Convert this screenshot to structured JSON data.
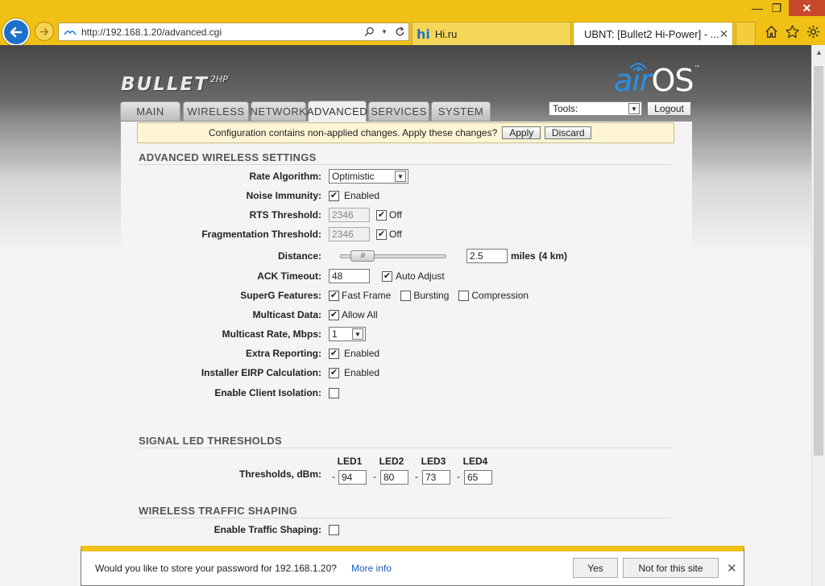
{
  "browser": {
    "address": "http://192.168.1.20/advanced.cgi",
    "tabs": [
      {
        "label": "Hi.ru",
        "logo": "hi"
      },
      {
        "label": "UBNT: [Bullet2 Hi-Power] - ..."
      }
    ],
    "colors": {
      "frame": "#f0c014",
      "back_button": "#1e6fc9",
      "close_button": "#c7482a"
    },
    "icons": [
      "back-arrow-icon",
      "forward-arrow-icon",
      "search-icon",
      "refresh-icon",
      "home-icon",
      "favorites-star-icon",
      "settings-gear-icon"
    ]
  },
  "header": {
    "device_logo": "BULLET",
    "device_model": "2HP",
    "brand_air": "air",
    "brand_os": "OS",
    "brand_tm": "™"
  },
  "nav": {
    "tabs": [
      "MAIN",
      "WIRELESS",
      "NETWORK",
      "ADVANCED",
      "SERVICES",
      "SYSTEM"
    ],
    "active": "ADVANCED",
    "tools_selected": "Tools:",
    "logout_label": "Logout"
  },
  "notice": {
    "message": "Configuration contains non-applied changes. Apply these changes?",
    "apply_label": "Apply",
    "discard_label": "Discard"
  },
  "advanced_wireless": {
    "title": "ADVANCED WIRELESS SETTINGS",
    "rate_algorithm": {
      "label": "Rate Algorithm:",
      "value": "Optimistic"
    },
    "noise_immunity": {
      "label": "Noise Immunity:",
      "checked": true,
      "text": "Enabled"
    },
    "rts_threshold": {
      "label": "RTS Threshold:",
      "value": "2346",
      "off_checked": true,
      "off_text": "Off"
    },
    "fragmentation_threshold": {
      "label": "Fragmentation Threshold:",
      "value": "2346",
      "off_checked": true,
      "off_text": "Off"
    },
    "distance": {
      "label": "Distance:",
      "value": "2.5",
      "unit": "miles",
      "metric": "(4 km)"
    },
    "ack_timeout": {
      "label": "ACK Timeout:",
      "value": "48",
      "auto_checked": true,
      "auto_text": "Auto Adjust"
    },
    "superg": {
      "label": "SuperG Features:",
      "fast_frame": {
        "checked": true,
        "text": "Fast Frame"
      },
      "bursting": {
        "checked": false,
        "text": "Bursting"
      },
      "compression": {
        "checked": false,
        "text": "Compression"
      }
    },
    "multicast_data": {
      "label": "Multicast Data:",
      "checked": true,
      "text": "Allow All"
    },
    "multicast_rate": {
      "label": "Multicast Rate, Mbps:",
      "value": "1"
    },
    "extra_reporting": {
      "label": "Extra Reporting:",
      "checked": true,
      "text": "Enabled"
    },
    "installer_eirp": {
      "label": "Installer EIRP Calculation:",
      "checked": true,
      "text": "Enabled"
    },
    "client_isolation": {
      "label": "Enable Client Isolation:",
      "checked": false
    }
  },
  "signal_led": {
    "title": "SIGNAL LED THRESHOLDS",
    "label": "Thresholds, dBm:",
    "headers": [
      "LED1",
      "LED2",
      "LED3",
      "LED4"
    ],
    "values": [
      "94",
      "80",
      "73",
      "65"
    ],
    "prefix": "-"
  },
  "traffic_shaping": {
    "title": "WIRELESS TRAFFIC SHAPING",
    "enable_label": "Enable Traffic Shaping:",
    "enable_checked": false
  },
  "password_bar": {
    "message": "Would you like to store your password for 192.168.1.20?",
    "more_info": "More info",
    "yes_label": "Yes",
    "no_label": "Not for this site"
  }
}
